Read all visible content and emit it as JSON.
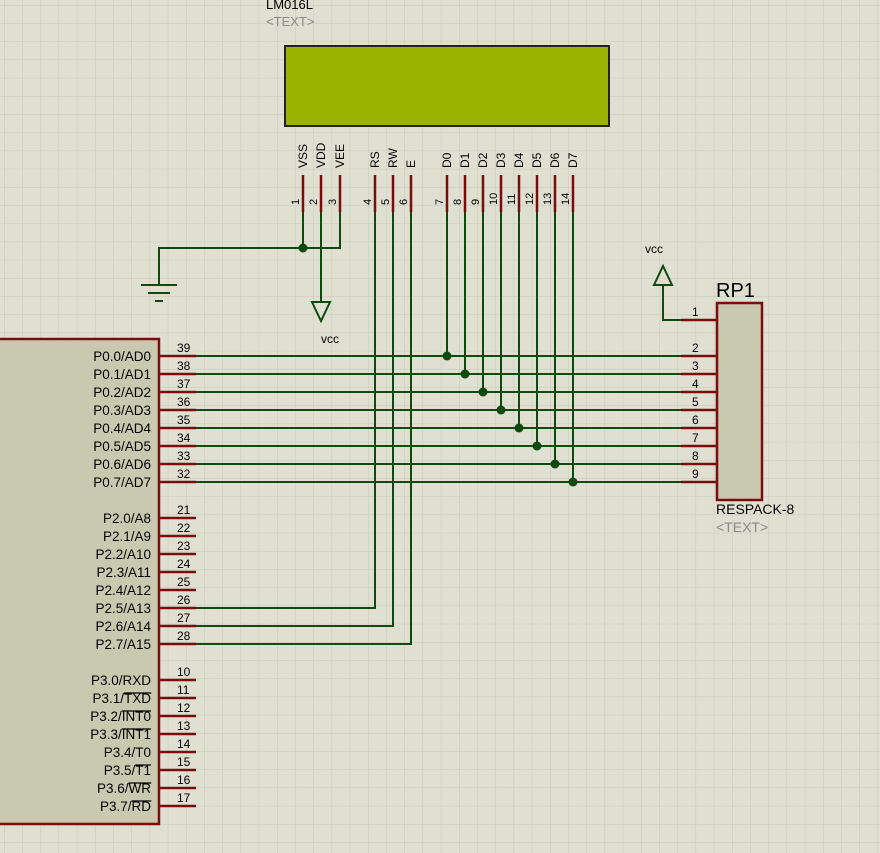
{
  "colors": {
    "background": "#e0e0d2",
    "grid": "#c9c9ba",
    "wire": "#0e4a0e",
    "pin": "#7a0c0c",
    "body_fill": "#c9c9b0",
    "body_border": "#7a0c0c",
    "lcd_screen": "#99b400",
    "text": "#000000",
    "placeholder_text": "#8a8a8a"
  },
  "lcd": {
    "name": "LM016L",
    "text_placeholder": "<TEXT>",
    "pins": [
      {
        "name": "VSS",
        "number": "1"
      },
      {
        "name": "VDD",
        "number": "2"
      },
      {
        "name": "VEE",
        "number": "3"
      },
      {
        "name": "RS",
        "number": "4"
      },
      {
        "name": "RW",
        "number": "5"
      },
      {
        "name": "E",
        "number": "6"
      },
      {
        "name": "D0",
        "number": "7"
      },
      {
        "name": "D1",
        "number": "8"
      },
      {
        "name": "D2",
        "number": "9"
      },
      {
        "name": "D3",
        "number": "10"
      },
      {
        "name": "D4",
        "number": "11"
      },
      {
        "name": "D5",
        "number": "12"
      },
      {
        "name": "D6",
        "number": "13"
      },
      {
        "name": "D7",
        "number": "14"
      }
    ]
  },
  "power": {
    "lcd_vcc_label": "vcc",
    "rp1_vcc_label": "vcc"
  },
  "resistor_pack": {
    "ref": "RP1",
    "value": "RESPACK-8",
    "text_placeholder": "<TEXT>",
    "pins": [
      "1",
      "2",
      "3",
      "4",
      "5",
      "6",
      "7",
      "8",
      "9"
    ]
  },
  "mcu": {
    "pins": [
      {
        "name": "P0.0/AD0",
        "number": "39"
      },
      {
        "name": "P0.1/AD1",
        "number": "38"
      },
      {
        "name": "P0.2/AD2",
        "number": "37"
      },
      {
        "name": "P0.3/AD3",
        "number": "36"
      },
      {
        "name": "P0.4/AD4",
        "number": "35"
      },
      {
        "name": "P0.5/AD5",
        "number": "34"
      },
      {
        "name": "P0.6/AD6",
        "number": "33"
      },
      {
        "name": "P0.7/AD7",
        "number": "32"
      },
      {
        "name": "P2.0/A8",
        "number": "21"
      },
      {
        "name": "P2.1/A9",
        "number": "22"
      },
      {
        "name": "P2.2/A10",
        "number": "23"
      },
      {
        "name": "P2.3/A11",
        "number": "24"
      },
      {
        "name": "P2.4/A12",
        "number": "25"
      },
      {
        "name": "P2.5/A13",
        "number": "26"
      },
      {
        "name": "P2.6/A14",
        "number": "27"
      },
      {
        "name": "P2.7/A15",
        "number": "28"
      },
      {
        "name": "P3.0/RXD",
        "number": "10"
      },
      {
        "name": "P3.1/TXD",
        "number": "11",
        "overline": "TXD"
      },
      {
        "name": "P3.2/INT0",
        "number": "12",
        "overline": "INT0"
      },
      {
        "name": "P3.3/INT1",
        "number": "13",
        "overline": "INT1"
      },
      {
        "name": "P3.4/T0",
        "number": "14"
      },
      {
        "name": "P3.5/T1",
        "number": "15",
        "overline": "T1"
      },
      {
        "name": "P3.6/WR",
        "number": "16",
        "overline": "WR"
      },
      {
        "name": "P3.7/RD",
        "number": "17",
        "overline": "RD"
      }
    ]
  }
}
